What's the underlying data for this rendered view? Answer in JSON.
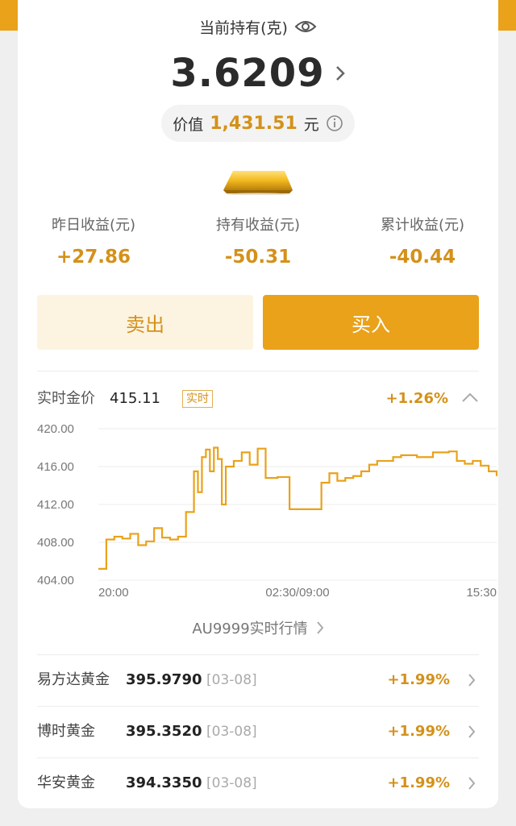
{
  "holding": {
    "label": "当前持有(克)",
    "amount": "3.6209",
    "value_label": "价值",
    "value_amount": "1,431.51",
    "value_unit": "元"
  },
  "stats": [
    {
      "label": "昨日收益(元)",
      "value": "+27.86"
    },
    {
      "label": "持有收益(元)",
      "value": "-50.31"
    },
    {
      "label": "累计收益(元)",
      "value": "-40.44"
    }
  ],
  "actions": {
    "sell": "卖出",
    "buy": "买入"
  },
  "realtime": {
    "label": "实时金价",
    "price": "415.11",
    "badge": "实时",
    "change": "+1.26%"
  },
  "chart_data": {
    "type": "line",
    "ylim": [
      404,
      420
    ],
    "yticks": [
      "420.00",
      "416.00",
      "412.00",
      "408.00",
      "404.00"
    ],
    "xticks": [
      "20:00",
      "02:30/09:00",
      "15:30"
    ],
    "x": [
      0,
      0.02,
      0.04,
      0.06,
      0.08,
      0.1,
      0.12,
      0.14,
      0.16,
      0.18,
      0.2,
      0.22,
      0.24,
      0.25,
      0.26,
      0.27,
      0.28,
      0.29,
      0.3,
      0.31,
      0.32,
      0.34,
      0.36,
      0.38,
      0.4,
      0.42,
      0.45,
      0.48,
      0.5,
      0.52,
      0.54,
      0.56,
      0.58,
      0.6,
      0.62,
      0.64,
      0.66,
      0.68,
      0.7,
      0.72,
      0.74,
      0.76,
      0.78,
      0.8,
      0.82,
      0.84,
      0.86,
      0.88,
      0.9,
      0.92,
      0.94,
      0.96,
      0.98,
      1.0
    ],
    "y": [
      405.2,
      408.3,
      408.6,
      408.4,
      408.9,
      407.7,
      408.1,
      409.5,
      408.5,
      408.3,
      408.6,
      411.2,
      415.5,
      413.3,
      417.0,
      417.8,
      415.5,
      418.0,
      416.8,
      412.0,
      416.0,
      416.6,
      417.5,
      416.2,
      417.9,
      414.8,
      414.9,
      411.5,
      411.5,
      411.5,
      411.5,
      414.3,
      415.3,
      414.5,
      414.8,
      415.0,
      415.5,
      416.2,
      416.6,
      416.6,
      417.0,
      417.2,
      417.2,
      417.0,
      417.0,
      417.5,
      417.5,
      417.6,
      416.6,
      416.3,
      416.6,
      416.1,
      415.5,
      415.0
    ]
  },
  "au_link": "AU9999实时行情",
  "funds": [
    {
      "name": "易方达黄金",
      "price": "395.9790",
      "date": "[03-08]",
      "change": "+1.99%"
    },
    {
      "name": "博时黄金",
      "price": "395.3520",
      "date": "[03-08]",
      "change": "+1.99%"
    },
    {
      "name": "华安黄金",
      "price": "394.3350",
      "date": "[03-08]",
      "change": "+1.99%"
    }
  ],
  "colors": {
    "accent": "#e9a21a",
    "accent_text": "#d4911a",
    "sell_bg": "#fcf4e0"
  }
}
